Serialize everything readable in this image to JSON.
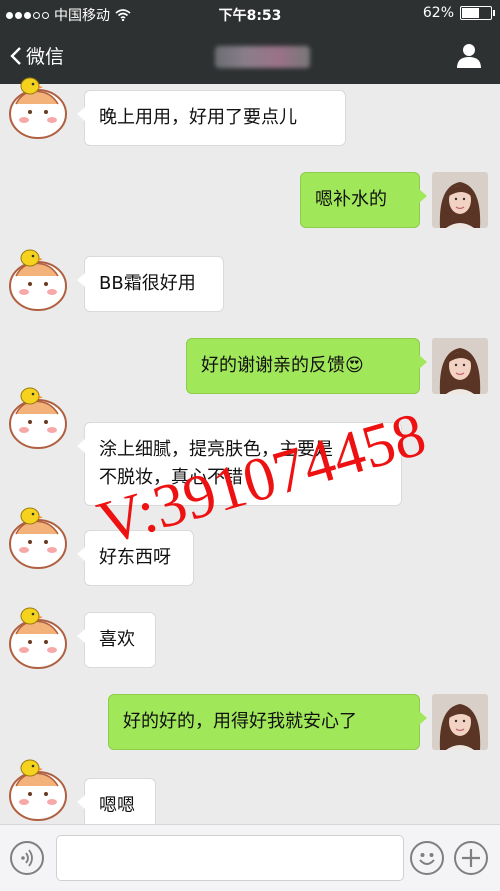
{
  "status_bar": {
    "carrier": "中国移动",
    "time": "下午8:53",
    "battery": "62%",
    "battery_level": 0.62
  },
  "nav": {
    "back_label": "微信"
  },
  "messages": [
    {
      "side": "in",
      "text": "晚上用用，好用了要点儿"
    },
    {
      "side": "out",
      "text": "嗯补水的"
    },
    {
      "side": "in",
      "text": "BB霜很好用"
    },
    {
      "side": "out",
      "text": "好的谢谢亲的反馈😍"
    },
    {
      "side": "in",
      "text": "涂上细腻，提亮肤色，主要是\n不脱妆，真心不错"
    },
    {
      "side": "in",
      "text": "好东西呀"
    },
    {
      "side": "in",
      "text": "喜欢"
    },
    {
      "side": "out",
      "text": "好的好的，用得好我就安心了"
    },
    {
      "side": "in",
      "text": "嗯嗯"
    }
  ],
  "watermark": "V:391074458",
  "icons": {
    "voice": "voice-icon",
    "emoji": "emoji-icon",
    "plus": "plus-icon",
    "back": "chevron-left-icon",
    "profile": "person-icon"
  },
  "colors": {
    "nav_bg": "#2e3132",
    "chat_bg": "#ebebeb",
    "out_bubble": "#a0e75a",
    "in_bubble": "#ffffff",
    "watermark": "#ee1111"
  }
}
